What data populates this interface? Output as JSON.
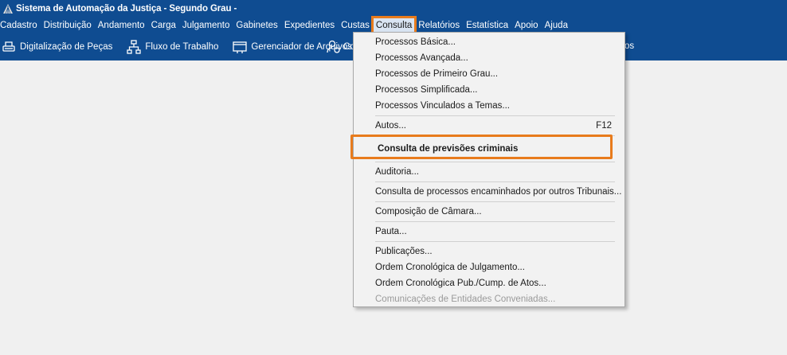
{
  "window": {
    "title": "Sistema de Automação da Justiça - Segundo Grau -",
    "icon": "tribunal-logo-icon"
  },
  "menubar": {
    "items": [
      "Cadastro",
      "Distribuição",
      "Andamento",
      "Carga",
      "Julgamento",
      "Gabinetes",
      "Expedientes",
      "Custas",
      "Consulta",
      "Relatórios",
      "Estatística",
      "Apoio",
      "Ajuda"
    ],
    "active": "Consulta"
  },
  "toolbar": {
    "items": [
      {
        "label": "Digitalização de Peças",
        "icon": "scanner-icon"
      },
      {
        "label": "Fluxo de Trabalho",
        "icon": "workflow-icon"
      },
      {
        "label": "Gerenciador de Arquivos",
        "icon": "file-manager-icon"
      }
    ],
    "partial_label": "Co",
    "partial_icon": "user-settings-icon",
    "tail_text": "os"
  },
  "consulta_menu": {
    "group1": [
      "Processos Básica...",
      "Processos Avançada...",
      "Processos de Primeiro Grau...",
      "Processos Simplificada...",
      "Processos Vinculados a Temas..."
    ],
    "autos": {
      "label": "Autos...",
      "shortcut": "F12"
    },
    "previsoes": "Consulta de previsões criminais",
    "auditoria": "Auditoria...",
    "encaminhados": "Consulta de processos encaminhados por outros Tribunais...",
    "camara": "Composição de Câmara...",
    "pauta": "Pauta...",
    "group_last": [
      "Publicações...",
      "Ordem Cronológica de Julgamento...",
      "Ordem Cronológica Pub./Cump. de Atos..."
    ],
    "disabled_item": "Comunicações de Entidades Conveniadas...",
    "accent_color": "#e87b1c",
    "bar_color": "#0f4c91"
  }
}
